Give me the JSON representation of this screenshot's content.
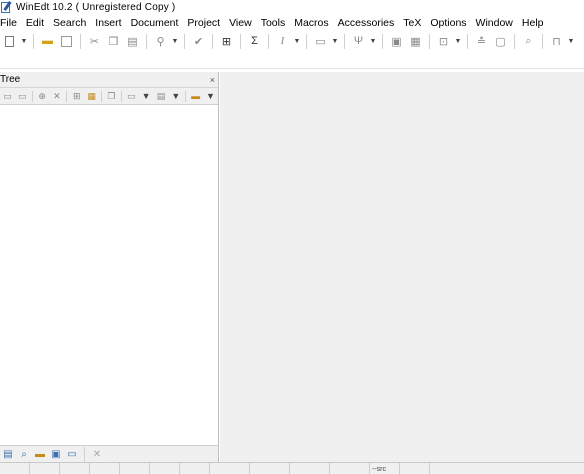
{
  "window": {
    "title": "WinEdt 10.2  ( Unregistered  Copy )"
  },
  "menu": {
    "items": [
      {
        "label": "File"
      },
      {
        "label": "Edit"
      },
      {
        "label": "Search"
      },
      {
        "label": "Insert"
      },
      {
        "label": "Document"
      },
      {
        "label": "Project"
      },
      {
        "label": "View"
      },
      {
        "label": "Tools"
      },
      {
        "label": "Macros"
      },
      {
        "label": "Accessories"
      },
      {
        "label": "TeX"
      },
      {
        "label": "Options"
      },
      {
        "label": "Window"
      },
      {
        "label": "Help"
      }
    ]
  },
  "tree_panel": {
    "title": "Tree",
    "close_symbol": "×"
  },
  "statusbar": {
    "mode": "--src"
  }
}
